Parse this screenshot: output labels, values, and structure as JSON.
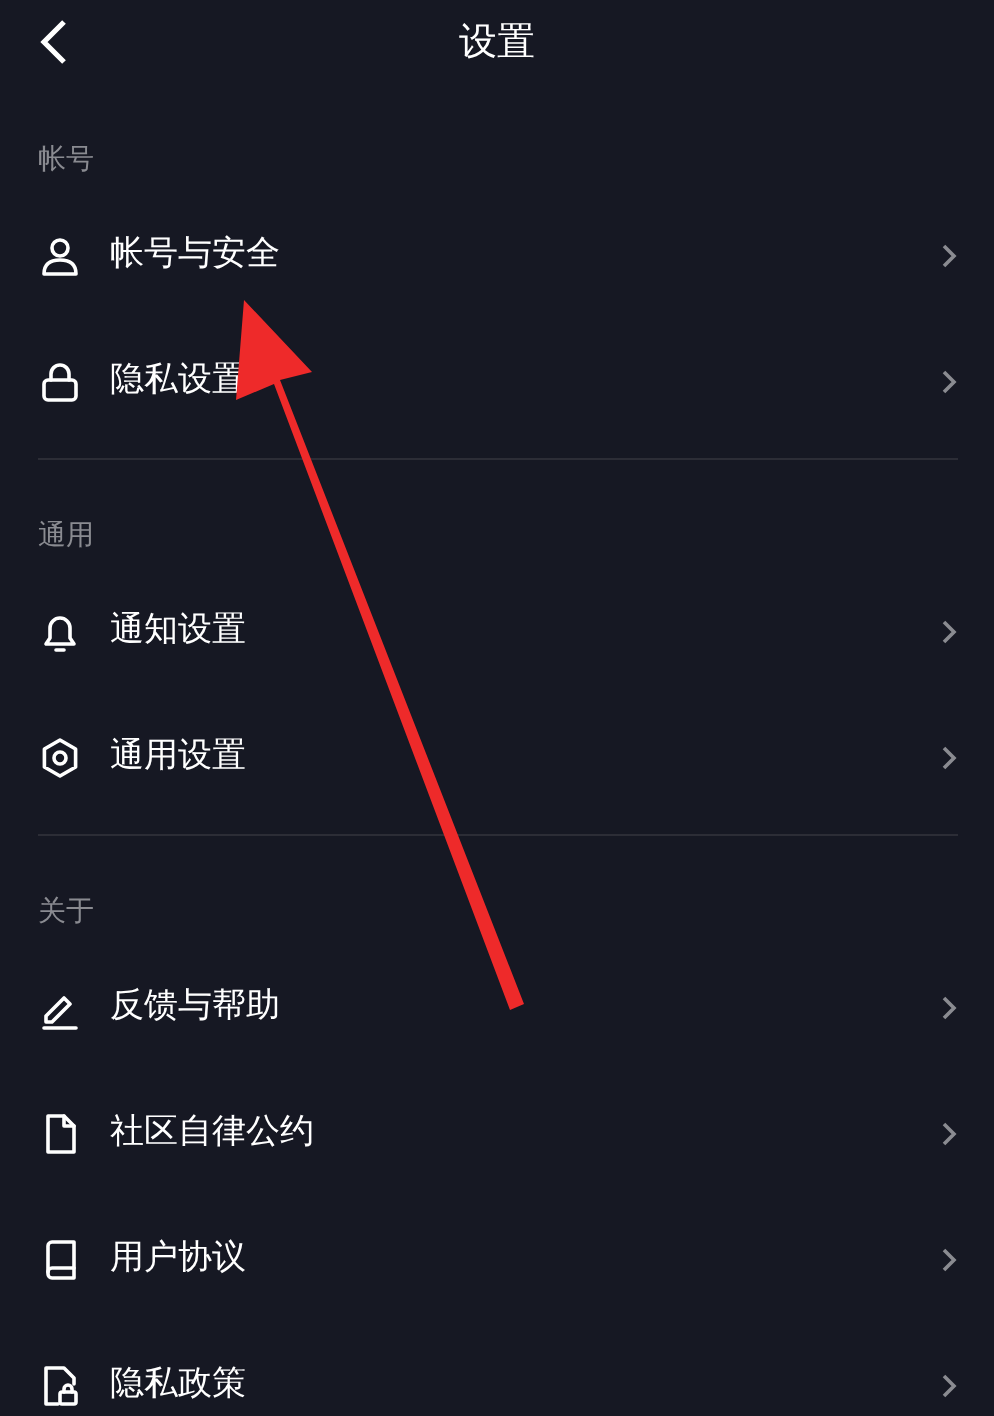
{
  "header": {
    "title": "设置"
  },
  "sections": [
    {
      "title": "帐号",
      "items": [
        {
          "label": "帐号与安全",
          "kind": "person"
        },
        {
          "label": "隐私设置",
          "kind": "lock"
        }
      ]
    },
    {
      "title": "通用",
      "items": [
        {
          "label": "通知设置",
          "kind": "bell"
        },
        {
          "label": "通用设置",
          "kind": "gear"
        }
      ]
    },
    {
      "title": "关于",
      "items": [
        {
          "label": "反馈与帮助",
          "kind": "pencil"
        },
        {
          "label": "社区自律公约",
          "kind": "file"
        },
        {
          "label": "用户协议",
          "kind": "book"
        },
        {
          "label": "隐私政策",
          "kind": "filelock"
        }
      ]
    }
  ]
}
